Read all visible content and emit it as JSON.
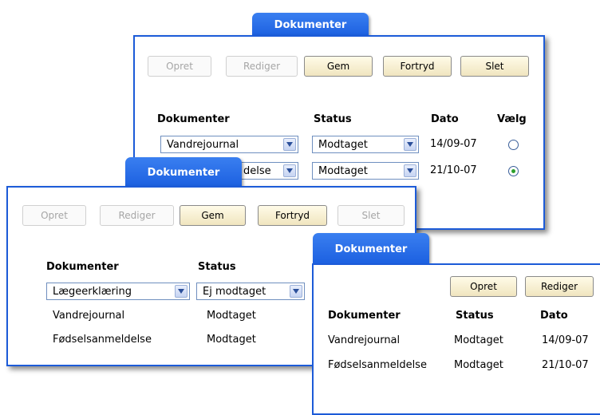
{
  "window1": {
    "tab": "Dokumenter",
    "buttons": {
      "opret": "Opret",
      "rediger": "Rediger",
      "gem": "Gem",
      "fortryd": "Fortryd",
      "slet": "Slet"
    },
    "headers": {
      "dokumenter": "Dokumenter",
      "status": "Status",
      "dato": "Dato",
      "vaelg": "Vælg"
    },
    "rows": [
      {
        "doc": "Vandrejournal",
        "status": "Modtaget",
        "date": "14/09-07",
        "selected": false
      },
      {
        "doc": "Fødselsanmeldelse",
        "status": "Modtaget",
        "date": "21/10-07",
        "selected": true
      }
    ],
    "row2_visible_doc": "delse"
  },
  "window2": {
    "tab": "Dokumenter",
    "buttons": {
      "opret": "Opret",
      "rediger": "Rediger",
      "gem": "Gem",
      "fortryd": "Fortryd",
      "slet": "Slet"
    },
    "headers": {
      "dokumenter": "Dokumenter",
      "status": "Status"
    },
    "rows": [
      {
        "doc": "Lægeerklæring",
        "status": "Ej modtaget"
      },
      {
        "doc": "Vandrejournal",
        "status": "Modtaget"
      },
      {
        "doc": "Fødselsanmeldelse",
        "status": "Modtaget"
      }
    ]
  },
  "window3": {
    "tab": "Dokumenter",
    "buttons": {
      "opret": "Opret",
      "rediger": "Rediger"
    },
    "headers": {
      "dokumenter": "Dokumenter",
      "status": "Status",
      "dato": "Dato"
    },
    "rows": [
      {
        "doc": "Vandrejournal",
        "status": "Modtaget",
        "date": "14/09-07"
      },
      {
        "doc": "Fødselsanmeldelse",
        "status": "Modtaget",
        "date": "21/10-07"
      }
    ]
  },
  "colors": {
    "accent": "#1c5bd8",
    "tab": "#2a6ff0",
    "button_enabled": "#f5ecc8",
    "radio_selected": "#2ca02c"
  }
}
